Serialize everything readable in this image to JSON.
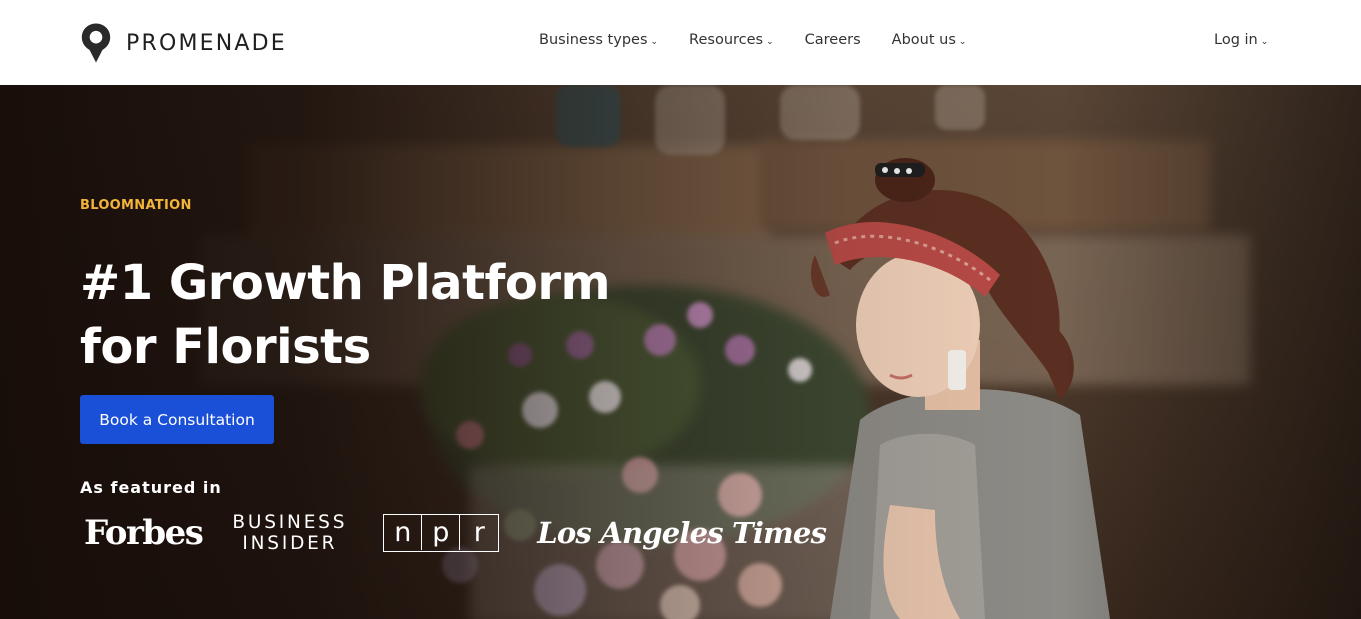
{
  "brand": {
    "name": "PROMENADE",
    "logo_icon": "map-pin-icon"
  },
  "nav": {
    "items": [
      {
        "label": "Business types",
        "has_dropdown": true
      },
      {
        "label": "Resources",
        "has_dropdown": true
      },
      {
        "label": "Careers",
        "has_dropdown": false
      },
      {
        "label": "About us",
        "has_dropdown": true
      }
    ],
    "caret": "⌄",
    "login": {
      "label": "Log in",
      "has_dropdown": true
    }
  },
  "hero": {
    "eyebrow": "BLOOMNATION",
    "headline_line1": "#1 Growth Platform",
    "headline_line2": "for Florists",
    "cta_label": "Book a Consultation",
    "featured_label": "As featured in",
    "press": {
      "forbes": "Forbes",
      "business_insider_line1": "BUSINESS",
      "business_insider_line2": "INSIDER",
      "npr": [
        "n",
        "p",
        "r"
      ],
      "la_times": "Los Angeles Times"
    }
  },
  "colors": {
    "accent": "#1a4fd8",
    "eyebrow": "#f2b43a",
    "header_bg": "#ffffff",
    "hero_dark": "#1a0f0a"
  }
}
